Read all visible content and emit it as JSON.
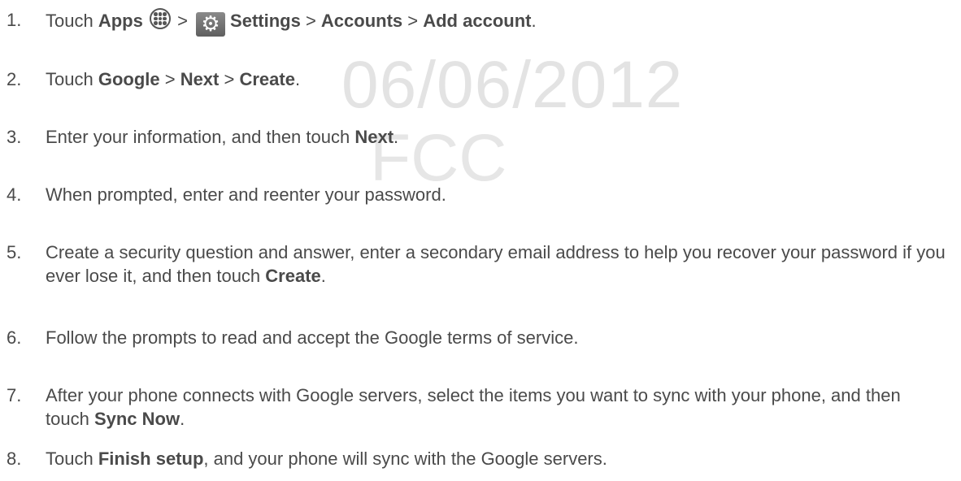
{
  "watermark": {
    "date": "06/06/2012",
    "agency": "FCC"
  },
  "icons": {
    "apps": "apps-grid-icon",
    "settings": "settings-gear-icon"
  },
  "steps": [
    {
      "num": "1.",
      "t1": "Touch ",
      "b1": "Apps",
      "t2": " > ",
      "b2": "Settings",
      "t3": " > ",
      "b3": "Accounts",
      "t4": " > ",
      "b4": "Add account",
      "t5": "."
    },
    {
      "num": "2.",
      "t1": "Touch ",
      "b1": "Google",
      "t2": " > ",
      "b2": "Next",
      "t3": " > ",
      "b3": "Create",
      "t4": "."
    },
    {
      "num": "3.",
      "t1": "Enter your information, and then touch ",
      "b1": "Next",
      "t2": "."
    },
    {
      "num": "4.",
      "t1": "When prompted, enter and reenter your password."
    },
    {
      "num": "5.",
      "t1": "Create a security question and answer, enter a secondary email address to help you recover your password if you ever lose it, and then touch ",
      "b1": "Create",
      "t2": "."
    },
    {
      "num": "6.",
      "t1": "Follow the prompts to read and accept the Google terms of service."
    },
    {
      "num": "7.",
      "t1": "After your phone connects with Google servers, select the items you want to sync with your phone, and then touch ",
      "b1": "Sync Now",
      "t2": "."
    },
    {
      "num": "8.",
      "t1": "Touch ",
      "b1": "Finish setup",
      "t2": ", and your phone will sync with the Google servers."
    }
  ]
}
